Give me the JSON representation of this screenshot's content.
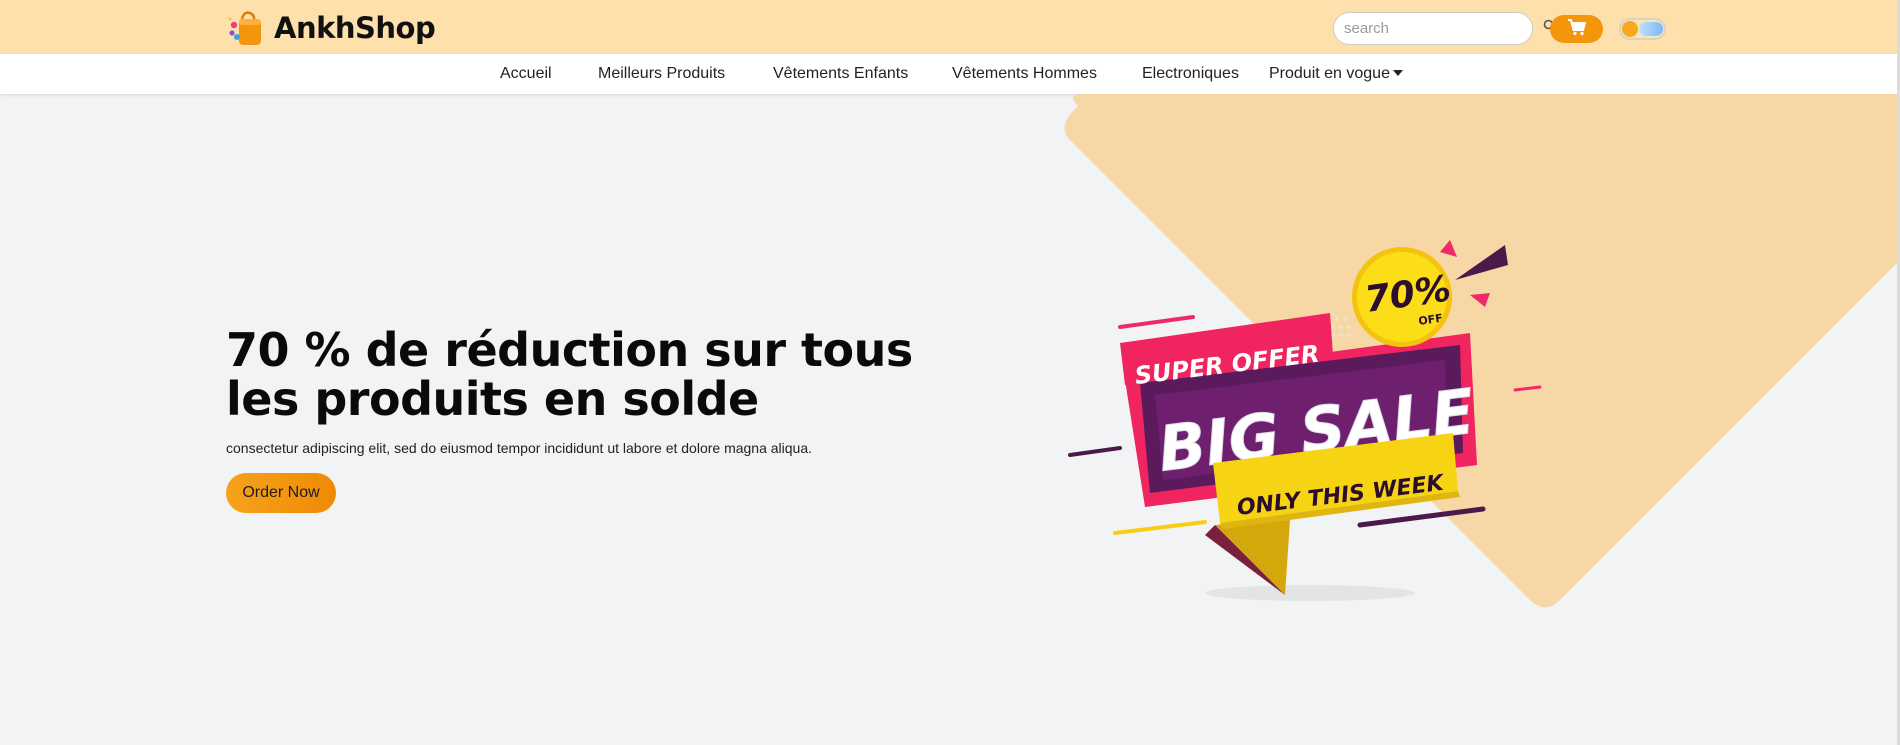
{
  "header": {
    "brand": "AnkhShop",
    "search_placeholder": "search"
  },
  "nav": {
    "items": [
      {
        "label": "Accueil"
      },
      {
        "label": "Meilleurs Produits"
      },
      {
        "label": "Vêtements Enfants"
      },
      {
        "label": "Vêtements Hommes"
      },
      {
        "label": "Electroniques"
      },
      {
        "label": "Produit en vogue"
      }
    ]
  },
  "hero": {
    "headline": "70 % de réduction sur tous les produits en solde",
    "subtext": "consectetur adipiscing elit, sed do eiusmod tempor incididunt ut labore et dolore magna aliqua.",
    "cta_label": "Order Now"
  },
  "promo": {
    "super_offer": "SUPER OFFER",
    "big_sale": "BIG SALE",
    "only_this_week": "ONLY THIS WEEK",
    "percent": "70%",
    "off": "OFF"
  },
  "colors": {
    "topbar": "#fde0ab",
    "accent": "#f4960b",
    "hero_shape": "#f8d7a6",
    "background": "#f2f3f5"
  },
  "icons": {
    "logo": "shopping-bag-icon",
    "search": "search-icon",
    "cart": "cart-icon",
    "theme": "theme-toggle-icon"
  }
}
